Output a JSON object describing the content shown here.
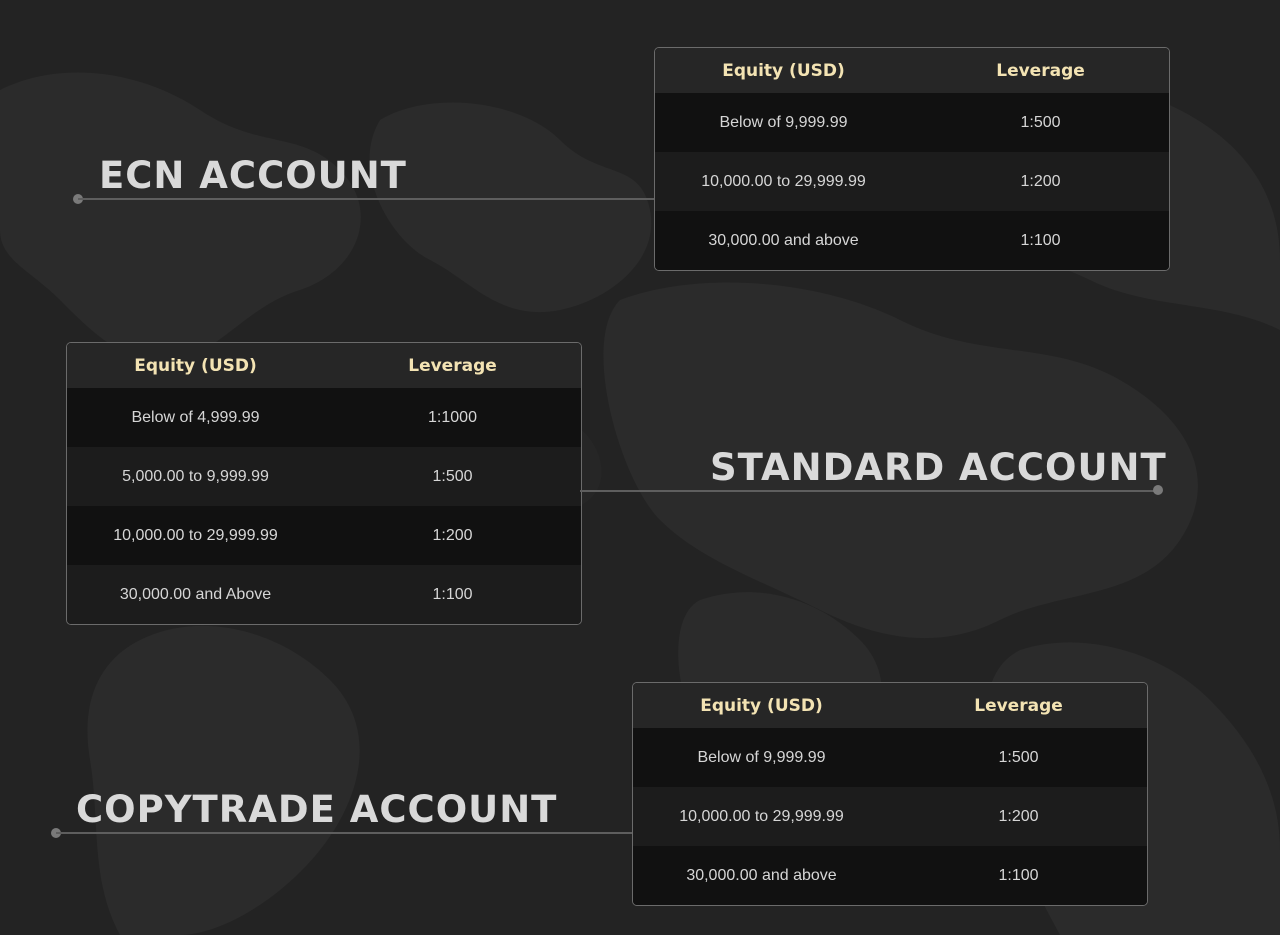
{
  "colors": {
    "background": "#232323",
    "title_text": "#d9d9d9",
    "header_text": "#f3e3b3",
    "cell_text": "#d6d6d6",
    "table_border": "#6b6b6b",
    "connector": "#5e5e5e"
  },
  "ecn": {
    "title": "ECN ACCOUNT",
    "headers": [
      "Equity (USD)",
      "Leverage"
    ],
    "rows": [
      [
        "Below of 9,999.99",
        "1:500"
      ],
      [
        "10,000.00 to 29,999.99",
        "1:200"
      ],
      [
        "30,000.00 and above",
        "1:100"
      ]
    ]
  },
  "standard": {
    "title": "STANDARD ACCOUNT",
    "headers": [
      "Equity (USD)",
      "Leverage"
    ],
    "rows": [
      [
        "Below of 4,999.99",
        "1:1000"
      ],
      [
        "5,000.00 to 9,999.99",
        "1:500"
      ],
      [
        "10,000.00 to 29,999.99",
        "1:200"
      ],
      [
        "30,000.00 and Above",
        "1:100"
      ]
    ]
  },
  "copytrade": {
    "title": "COPYTRADE ACCOUNT",
    "headers": [
      "Equity (USD)",
      "Leverage"
    ],
    "rows": [
      [
        "Below of 9,999.99",
        "1:500"
      ],
      [
        "10,000.00 to 29,999.99",
        "1:200"
      ],
      [
        "30,000.00 and above",
        "1:100"
      ]
    ]
  }
}
